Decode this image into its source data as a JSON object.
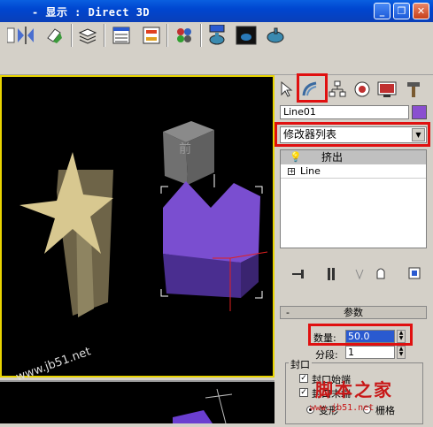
{
  "window": {
    "title": "- 显示 : Direct 3D"
  },
  "icons": [
    "minimize-icon",
    "restore-icon",
    "close-icon",
    "mirror-icon",
    "align-icon",
    "layers-icon",
    "curve-editor-icon",
    "schematic-icon",
    "material-editor-icon",
    "render-setup-icon",
    "render-frame-icon",
    "quick-render-icon",
    "select-icon",
    "modify-icon",
    "hierarchy-icon",
    "motion-icon",
    "display-icon",
    "utilities-icon",
    "pin-stack-icon",
    "show-end-result-icon",
    "make-unique-icon",
    "remove-modifier-icon",
    "configure-sets-icon",
    "lightbulb-icon",
    "expand-plus-icon"
  ],
  "viewport": {
    "cube_face_label": "前",
    "watermark": "www.jb51.net"
  },
  "command_panel": {
    "object_name": "Line01",
    "object_color": "#8a4fd0",
    "modifier_list": "修改器列表",
    "stack": [
      {
        "label": "挤出",
        "selected": true
      },
      {
        "label": "Line",
        "selected": false
      }
    ],
    "parameters": {
      "rollout_title": "参数",
      "amount_label": "数量:",
      "amount_value": "50.0",
      "segments_label": "分段:",
      "segments_value": "1",
      "capping_group": "封口",
      "cap_start_label": "封口始端",
      "cap_end_label": "封口末端",
      "morph_label": "变形",
      "grid_label": "栅格"
    }
  },
  "watermark": {
    "text": "脚本之家",
    "url": "www.jb51.net"
  },
  "highlight_color": "#e01010"
}
